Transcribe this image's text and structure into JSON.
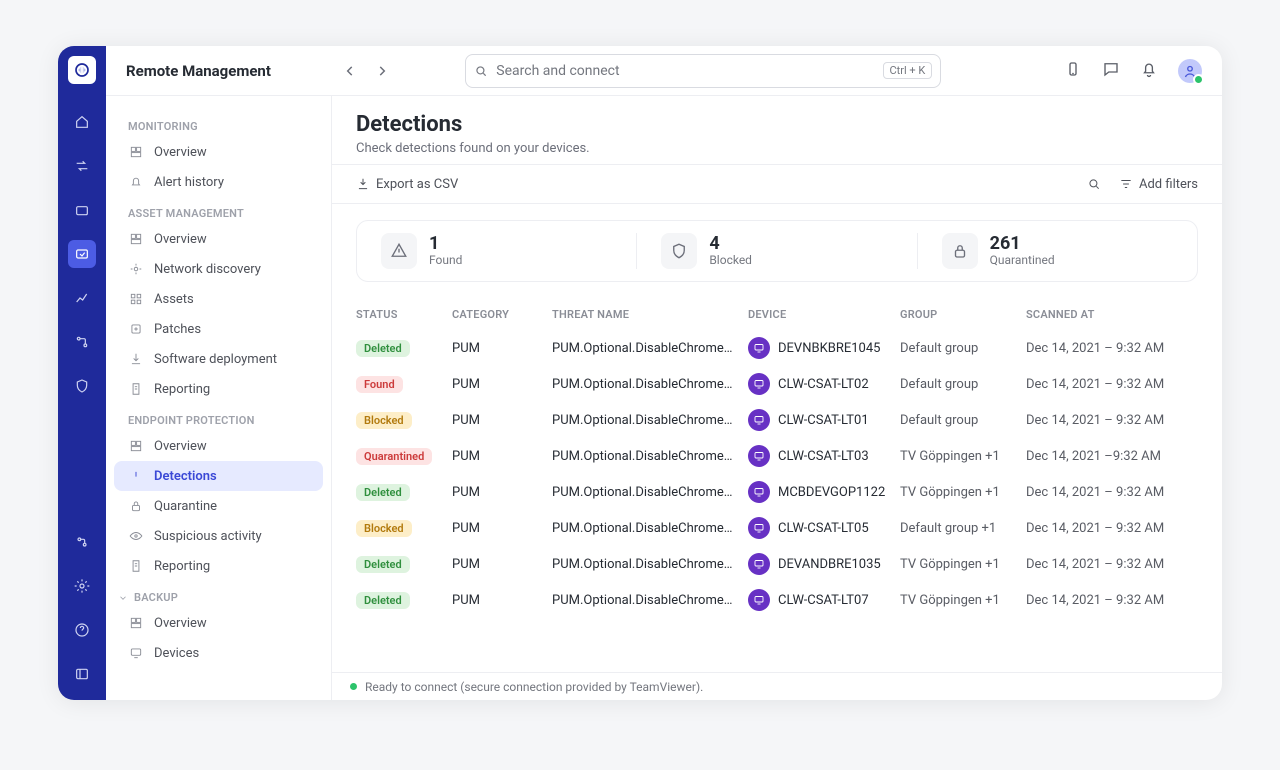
{
  "app": {
    "title": "Remote Management"
  },
  "search": {
    "placeholder": "Search and connect",
    "shortcut": "Ctrl + K"
  },
  "sidebar": {
    "monitoring": {
      "label": "MONITORING",
      "items": [
        "Overview",
        "Alert history"
      ]
    },
    "asset": {
      "label": "ASSET MANAGEMENT",
      "items": [
        "Overview",
        "Network discovery",
        "Assets",
        "Patches",
        "Software deployment",
        "Reporting"
      ]
    },
    "endpoint": {
      "label": "ENDPOINT PROTECTION",
      "items": [
        "Overview",
        "Detections",
        "Quarantine",
        "Suspicious activity",
        "Reporting"
      ]
    },
    "backup": {
      "label": "BACKUP",
      "items": [
        "Overview",
        "Devices"
      ]
    }
  },
  "page": {
    "title": "Detections",
    "subtitle": "Check detections found on your devices.",
    "export_label": "Export as CSV",
    "add_filters_label": "Add filters"
  },
  "stats": [
    {
      "value": "1",
      "label": "Found"
    },
    {
      "value": "4",
      "label": "Blocked"
    },
    {
      "value": "261",
      "label": "Quarantined"
    }
  ],
  "table": {
    "headers": [
      "STATUS",
      "CATEGORY",
      "THREAT NAME",
      "DEVICE",
      "GROUP",
      "SCANNED AT"
    ],
    "rows": [
      {
        "status": "Deleted",
        "status_class": "b-deleted",
        "category": "PUM",
        "threat": "PUM.Optional.DisableChrome…",
        "device": "DEVNBKBRE1045",
        "group": "Default group",
        "scanned": "Dec 14, 2021 – 9:32 AM"
      },
      {
        "status": "Found",
        "status_class": "b-found",
        "category": "PUM",
        "threat": "PUM.Optional.DisableChrome…",
        "device": "CLW-CSAT-LT02",
        "group": "Default group",
        "scanned": "Dec 14, 2021 – 9:32 AM"
      },
      {
        "status": "Blocked",
        "status_class": "b-blocked",
        "category": "PUM",
        "threat": "PUM.Optional.DisableChrome…",
        "device": "CLW-CSAT-LT01",
        "group": "Default group",
        "scanned": "Dec 14, 2021 – 9:32 AM"
      },
      {
        "status": "Quarantined",
        "status_class": "b-quarantined",
        "category": "PUM",
        "threat": "PUM.Optional.DisableChrome…",
        "device": "CLW-CSAT-LT03",
        "group": "TV Göppingen +1",
        "scanned": "Dec 14, 2021 –9:32 AM"
      },
      {
        "status": "Deleted",
        "status_class": "b-deleted",
        "category": "PUM",
        "threat": "PUM.Optional.DisableChrome…",
        "device": "MCBDEVGOP1122",
        "group": "TV Göppingen +1",
        "scanned": "Dec 14, 2021 – 9:32 AM"
      },
      {
        "status": "Blocked",
        "status_class": "b-blocked",
        "category": "PUM",
        "threat": "PUM.Optional.DisableChrome…",
        "device": "CLW-CSAT-LT05",
        "group": "Default group +1",
        "scanned": "Dec 14, 2021 – 9:32 AM"
      },
      {
        "status": "Deleted",
        "status_class": "b-deleted",
        "category": "PUM",
        "threat": "PUM.Optional.DisableChrome…",
        "device": "DEVANDBRE1035",
        "group": "TV Göppingen +1",
        "scanned": "Dec 14, 2021 – 9:32 AM"
      },
      {
        "status": "Deleted",
        "status_class": "b-deleted",
        "category": "PUM",
        "threat": "PUM.Optional.DisableChrome…",
        "device": "CLW-CSAT-LT07",
        "group": "TV Göppingen +1",
        "scanned": "Dec 14, 2021 – 9:32 AM"
      }
    ]
  },
  "footer": {
    "status": "Ready to connect (secure connection provided by TeamViewer)."
  }
}
